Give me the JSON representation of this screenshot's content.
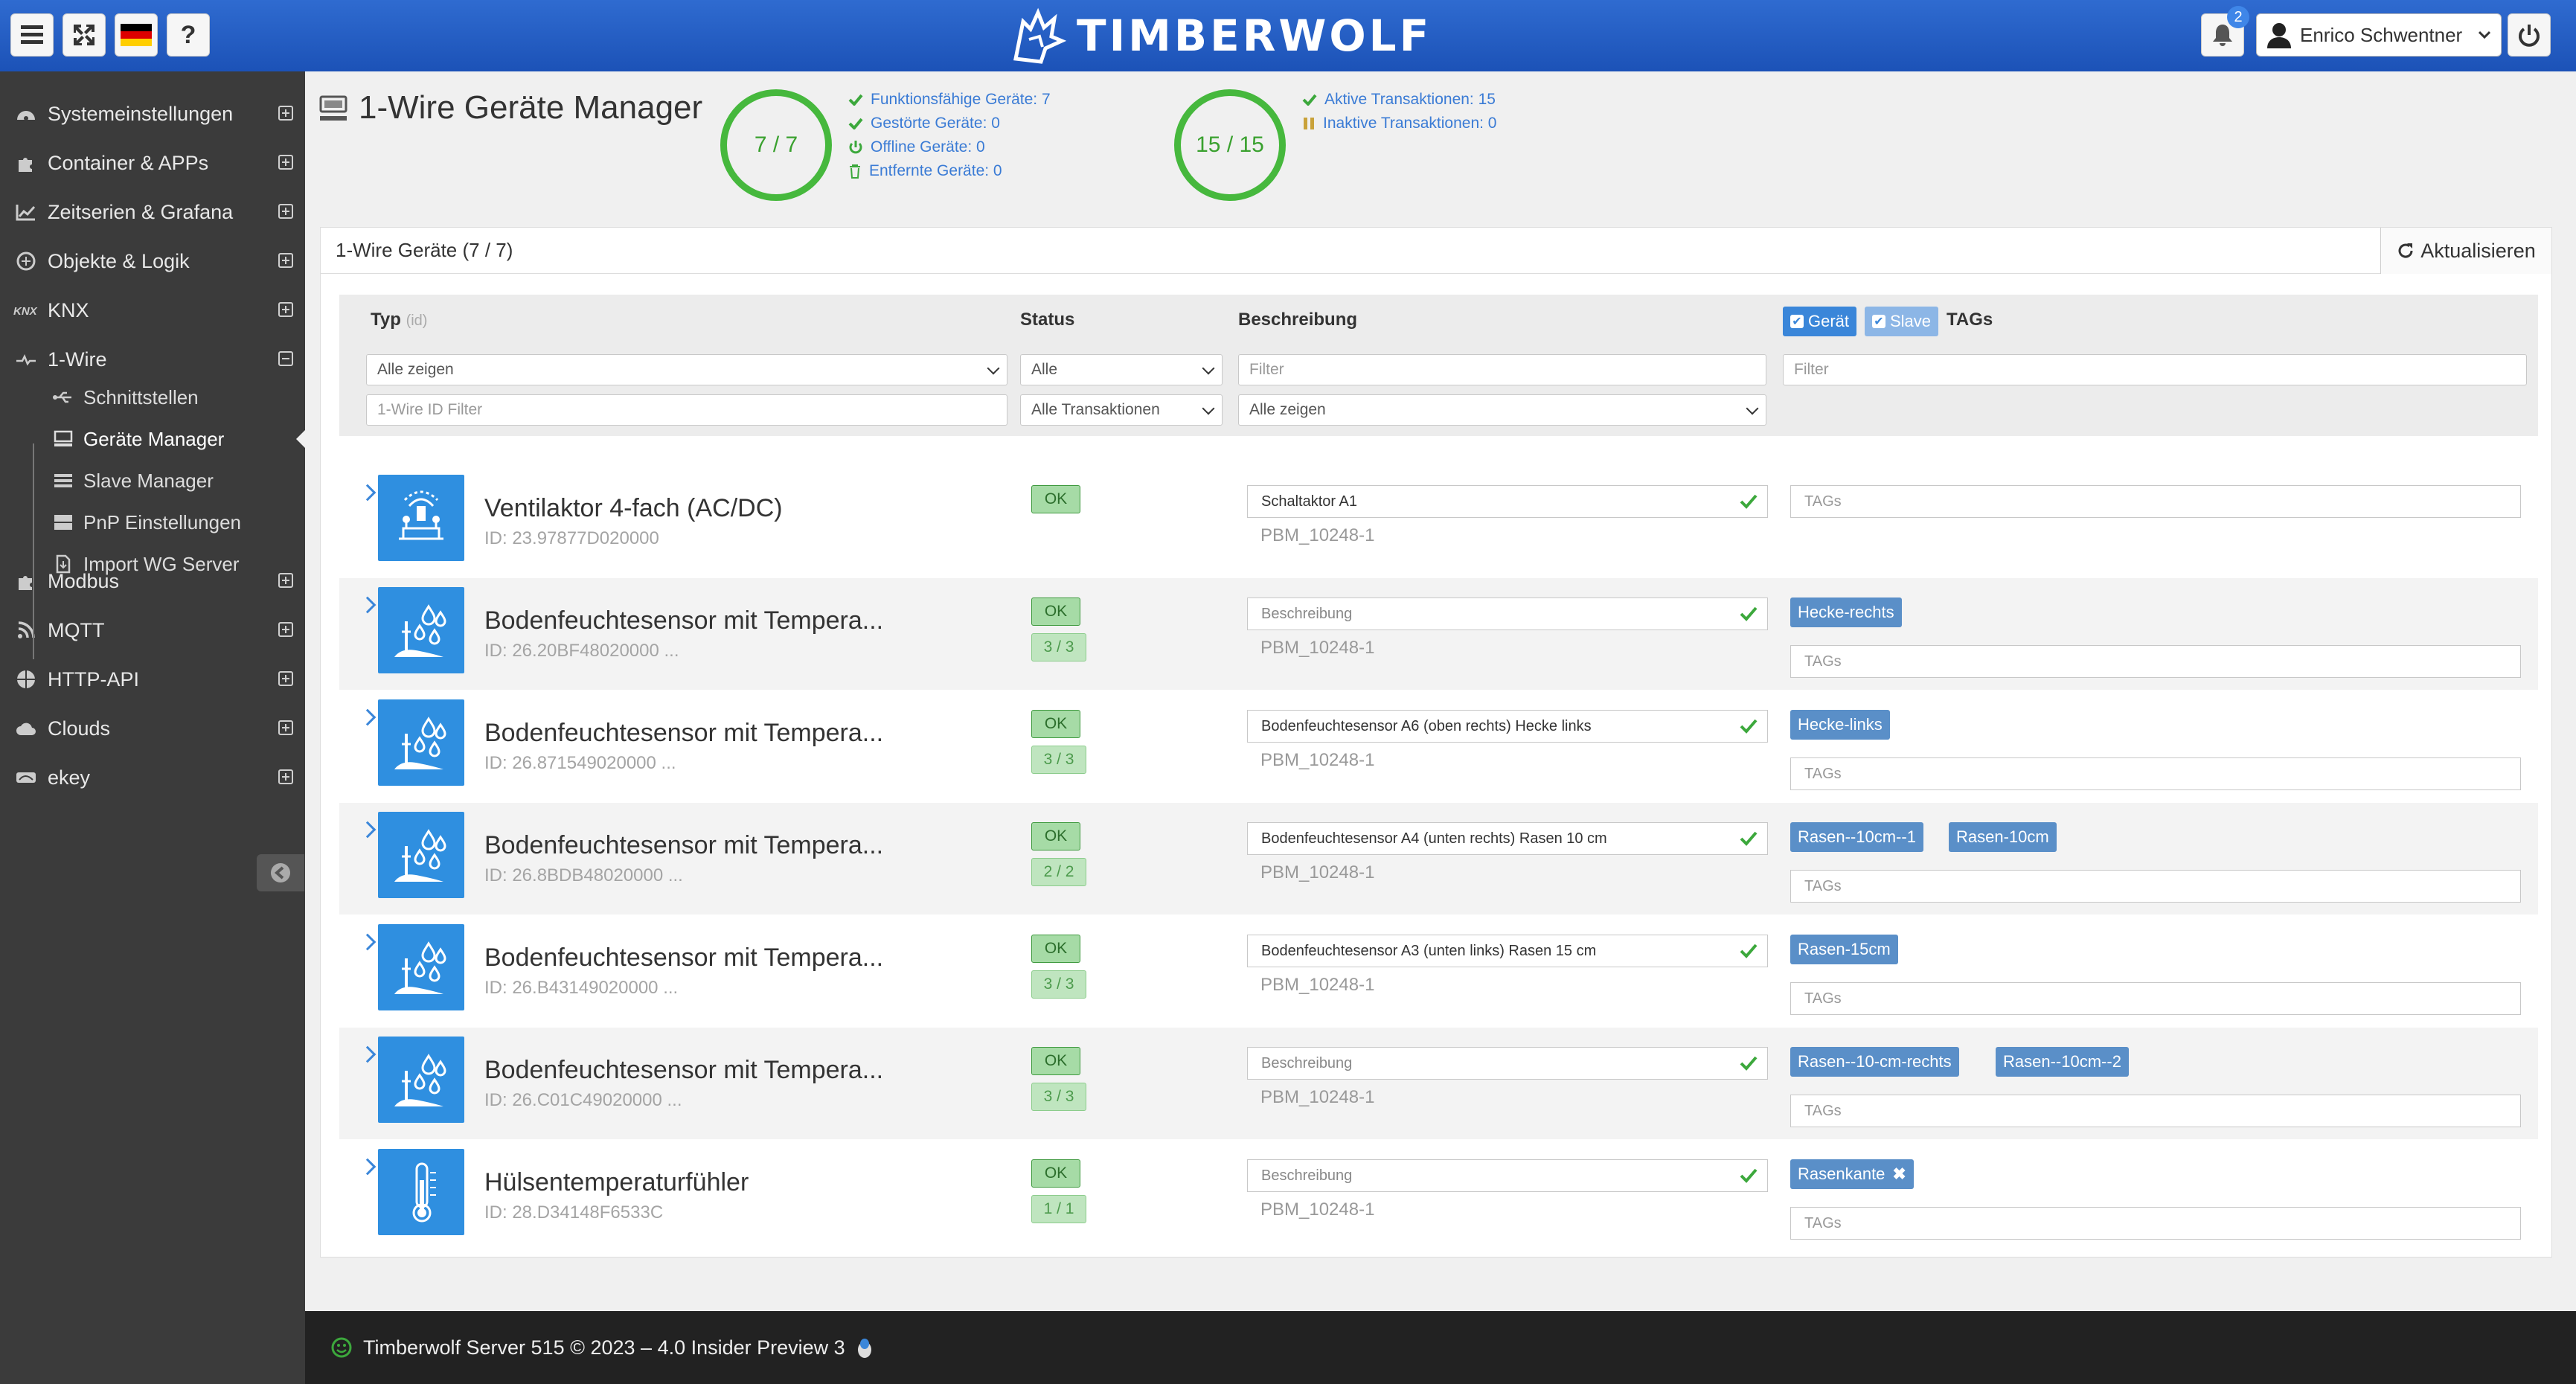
{
  "header": {
    "logo_text": "TIMBERWOLF",
    "notification_count": "2",
    "user_name": "Enrico Schwentner"
  },
  "sidebar": {
    "items": [
      {
        "label": "Systemeinstellungen",
        "icon": "dashboard-icon"
      },
      {
        "label": "Container & APPs",
        "icon": "puzzle-icon"
      },
      {
        "label": "Zeitserien & Grafana",
        "icon": "line-chart-icon"
      },
      {
        "label": "Objekte & Logik",
        "icon": "logic-icon"
      },
      {
        "label": "KNX",
        "icon": "knx-icon"
      },
      {
        "label": "1-Wire",
        "icon": "onewire-icon"
      },
      {
        "label": "Modbus",
        "icon": "puzzle-icon"
      },
      {
        "label": "MQTT",
        "icon": "rss-icon"
      },
      {
        "label": "HTTP-API",
        "icon": "globe-icon"
      },
      {
        "label": "Clouds",
        "icon": "cloud-icon"
      },
      {
        "label": "ekey",
        "icon": "ekey-icon"
      }
    ],
    "sub_items": [
      {
        "label": "Schnittstellen",
        "icon": "usb-icon"
      },
      {
        "label": "Geräte Manager",
        "icon": "devices-icon"
      },
      {
        "label": "Slave Manager",
        "icon": "list-icon"
      },
      {
        "label": "PnP Einstellungen",
        "icon": "server-icon"
      },
      {
        "label": "Import WG Server",
        "icon": "import-icon"
      }
    ]
  },
  "page": {
    "title": "1-Wire Geräte Manager",
    "devices_circle": "7 / 7",
    "transactions_circle": "15 / 15",
    "device_stats": [
      "Funktionsfähige Geräte: 7",
      "Gestörte Geräte: 0",
      "Offline Geräte: 0",
      "Entfernte Geräte: 0"
    ],
    "transaction_stats": [
      "Aktive Transaktionen: 15",
      "Inaktive Transaktionen: 0"
    ]
  },
  "panel": {
    "title": "1-Wire Geräte (7 / 7)",
    "refresh_label": "Aktualisieren"
  },
  "filters": {
    "col_type": "Typ",
    "col_type_hint": "(id)",
    "col_status": "Status",
    "col_desc": "Beschreibung",
    "col_tags": "TAGs",
    "chk_device": "Gerät",
    "chk_slave": "Slave",
    "type_select": "Alle zeigen",
    "id_placeholder": "1-Wire ID Filter",
    "status_select": "Alle",
    "trans_select": "Alle Transaktionen",
    "desc_placeholder": "Filter",
    "desc_select": "Alle zeigen",
    "tags_placeholder": "Filter"
  },
  "devices": [
    {
      "name": "Ventilaktor 4-fach (AC/DC)",
      "id": "ID: 23.97877D020000",
      "status": "OK",
      "trans": "",
      "desc": "Schaltaktor A1",
      "desc_placeholder": "",
      "slave": "PBM_10248-1",
      "tags": [],
      "tags_placeholder": "TAGs",
      "icon": "sprinkler-icon"
    },
    {
      "name": "Bodenfeuchtesensor mit Tempera...",
      "id": "ID: 26.20BF48020000 ...",
      "status": "OK",
      "trans": "3 / 3",
      "desc": "",
      "desc_placeholder": "Beschreibung",
      "slave": "PBM_10248-1",
      "tags": [
        "Hecke-rechts"
      ],
      "tags_placeholder": "TAGs",
      "icon": "soil-moisture-icon"
    },
    {
      "name": "Bodenfeuchtesensor mit Tempera...",
      "id": "ID: 26.871549020000 ...",
      "status": "OK",
      "trans": "3 / 3",
      "desc": "Bodenfeuchtesensor A6 (oben rechts) Hecke links",
      "desc_placeholder": "",
      "slave": "PBM_10248-1",
      "tags": [
        "Hecke-links"
      ],
      "tags_placeholder": "TAGs",
      "icon": "soil-moisture-icon"
    },
    {
      "name": "Bodenfeuchtesensor mit Tempera...",
      "id": "ID: 26.8BDB48020000 ...",
      "status": "OK",
      "trans": "2 / 2",
      "desc": "Bodenfeuchtesensor A4 (unten rechts) Rasen 10 cm",
      "desc_placeholder": "",
      "slave": "PBM_10248-1",
      "tags": [
        "Rasen--10cm--1",
        "Rasen-10cm"
      ],
      "tags_placeholder": "TAGs",
      "icon": "soil-moisture-icon"
    },
    {
      "name": "Bodenfeuchtesensor mit Tempera...",
      "id": "ID: 26.B43149020000 ...",
      "status": "OK",
      "trans": "3 / 3",
      "desc": "Bodenfeuchtesensor A3 (unten links) Rasen 15 cm",
      "desc_placeholder": "",
      "slave": "PBM_10248-1",
      "tags": [
        "Rasen-15cm"
      ],
      "tags_placeholder": "TAGs",
      "icon": "soil-moisture-icon"
    },
    {
      "name": "Bodenfeuchtesensor mit Tempera...",
      "id": "ID: 26.C01C49020000 ...",
      "status": "OK",
      "trans": "3 / 3",
      "desc": "",
      "desc_placeholder": "Beschreibung",
      "slave": "PBM_10248-1",
      "tags": [
        "Rasen--10-cm-rechts",
        "Rasen--10cm--2"
      ],
      "tags_placeholder": "TAGs",
      "icon": "soil-moisture-icon"
    },
    {
      "name": "Hülsentemperaturfühler",
      "id": "ID: 28.D34148F6533C",
      "status": "OK",
      "trans": "1 / 1",
      "desc": "",
      "desc_placeholder": "Beschreibung",
      "slave": "PBM_10248-1",
      "tags": [
        "Rasenkante"
      ],
      "tags_placeholder": "TAGs",
      "icon": "thermometer-icon"
    }
  ],
  "footer": {
    "text": "Timberwolf Server 515 © 2023 – 4.0 Insider Preview 3"
  }
}
